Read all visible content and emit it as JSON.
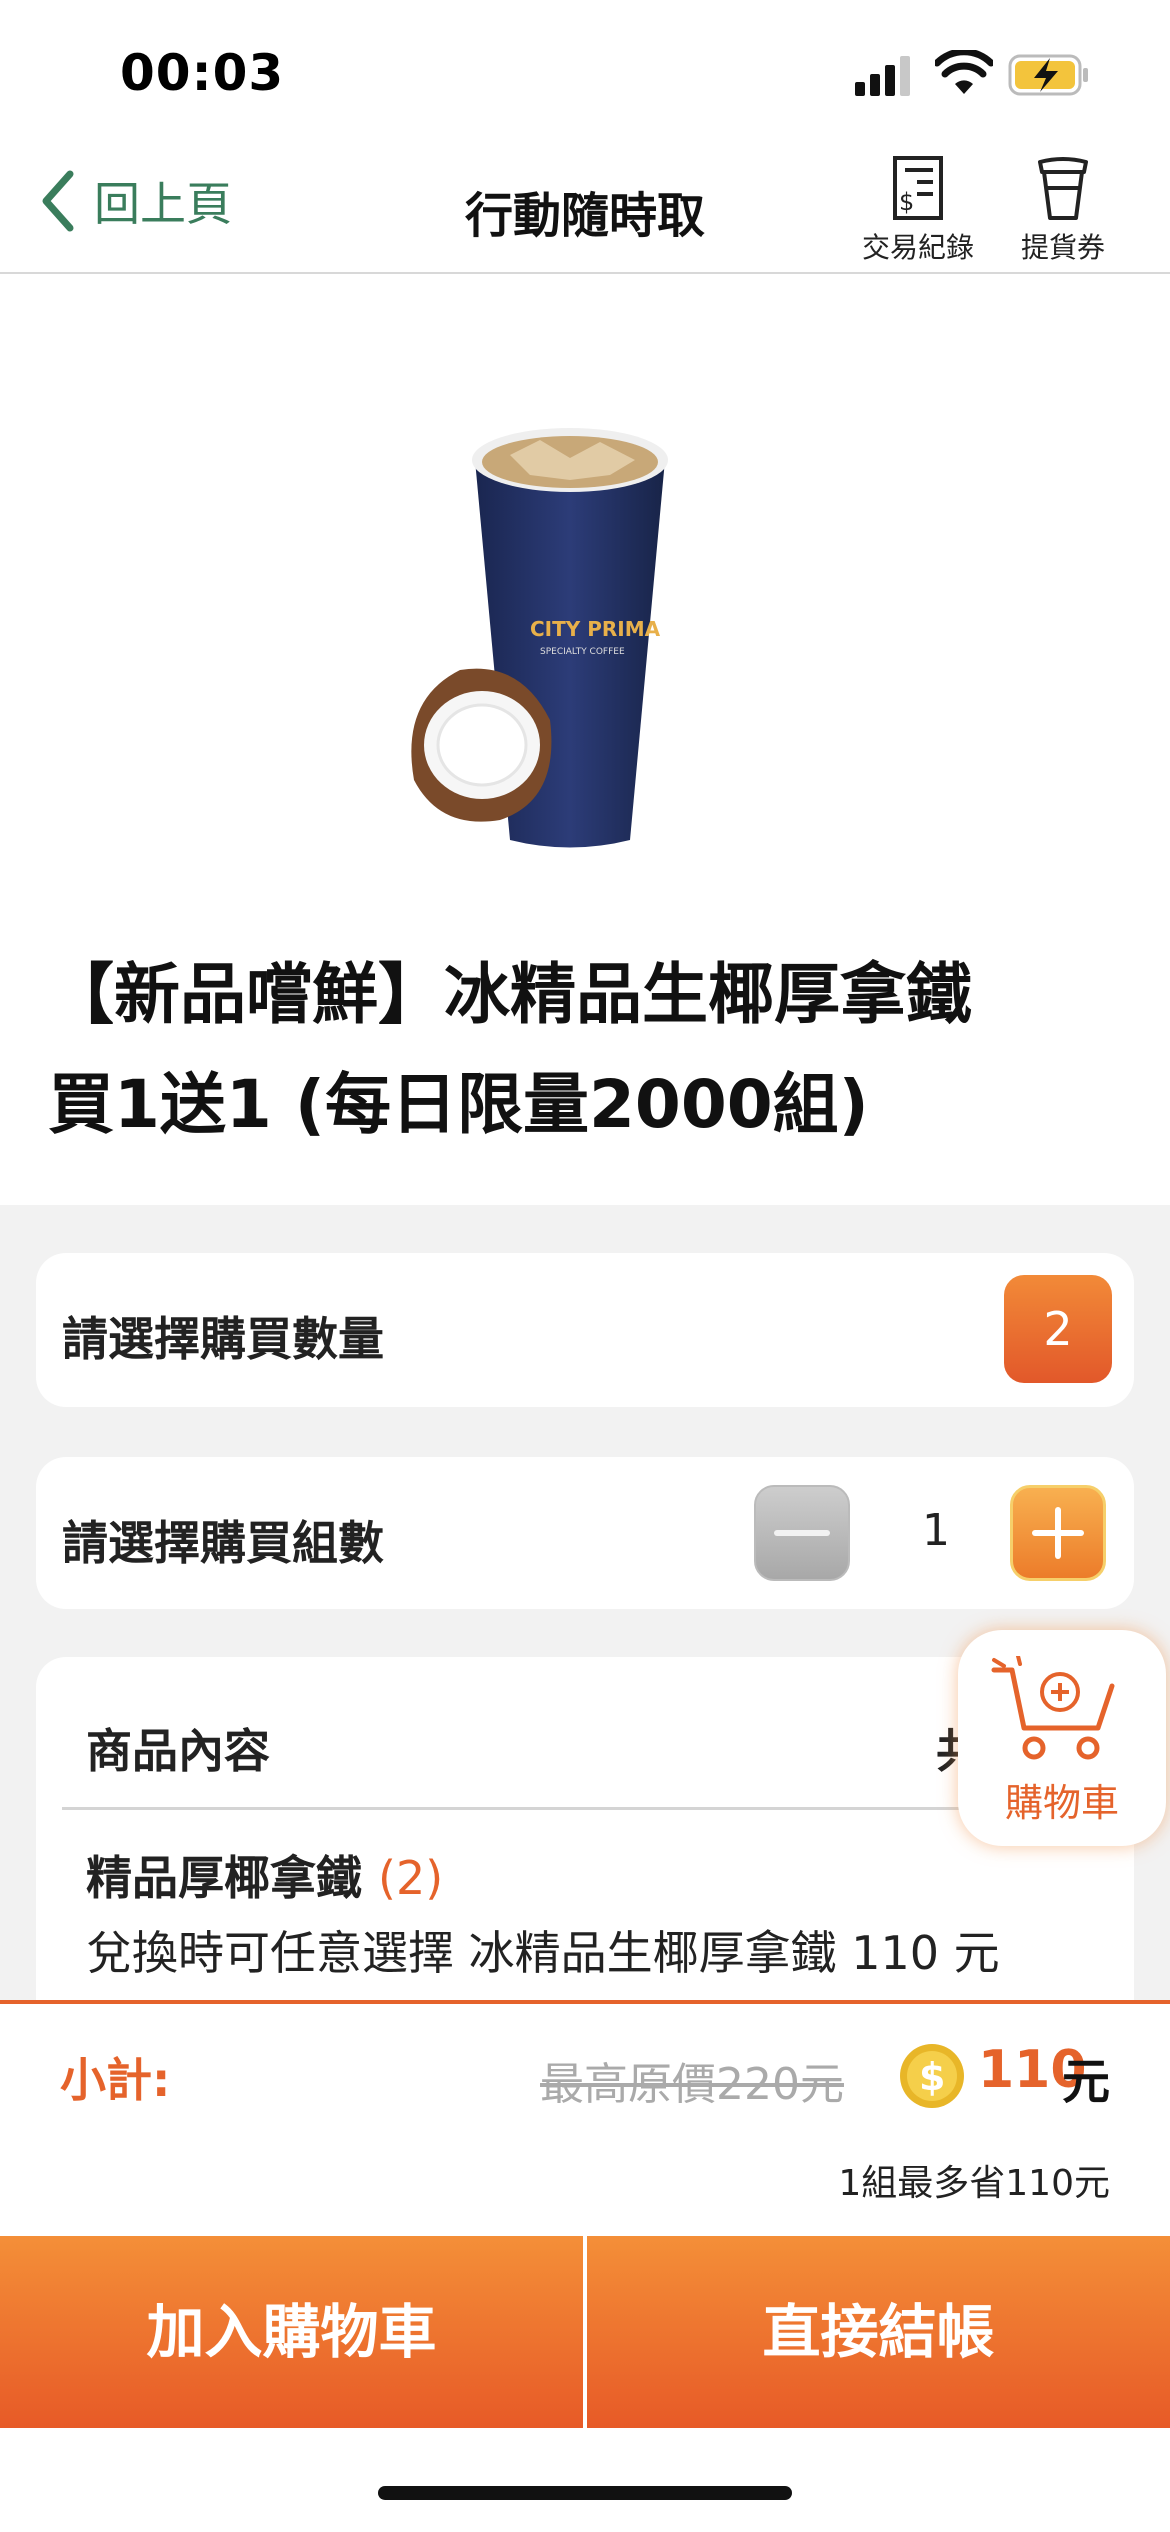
{
  "status_bar": {
    "time": "00:03"
  },
  "nav": {
    "back_label": "回上頁",
    "title": "行動隨時取",
    "actions": [
      {
        "label": "交易紀錄",
        "icon": "receipt-dollar-icon"
      },
      {
        "label": "提貨券",
        "icon": "coffee-cup-icon"
      }
    ]
  },
  "product": {
    "image": "iced-coconut-latte-city-prima-cup-image",
    "title_line1": "【新品嚐鮮】冰精品生椰厚拿鐵",
    "title_line2": "買1送1 (每日限量2000組)"
  },
  "quantity": {
    "label": "請選擇購買數量",
    "value": "2"
  },
  "sets": {
    "label": "請選擇購買組數",
    "value": "1"
  },
  "contents": {
    "header": "商品內容",
    "header_right_partial": "共",
    "item_name": "精品厚椰拿鐵",
    "item_qty": "(2)",
    "item_desc": "兌換時可任意選擇 冰精品生椰厚拿鐵 110 元"
  },
  "floating_cart": {
    "label": "購物車"
  },
  "subtotal": {
    "label": "小計:",
    "original_price": "最高原價220元",
    "price": "110",
    "unit": "元",
    "save_note": "1組最多省110元"
  },
  "buttons": {
    "add_to_cart": "加入購物車",
    "checkout": "直接結帳"
  },
  "colors": {
    "accent": "#e5632b",
    "back_green": "#3a7d5c",
    "grey_bg": "#f2f2f2"
  }
}
